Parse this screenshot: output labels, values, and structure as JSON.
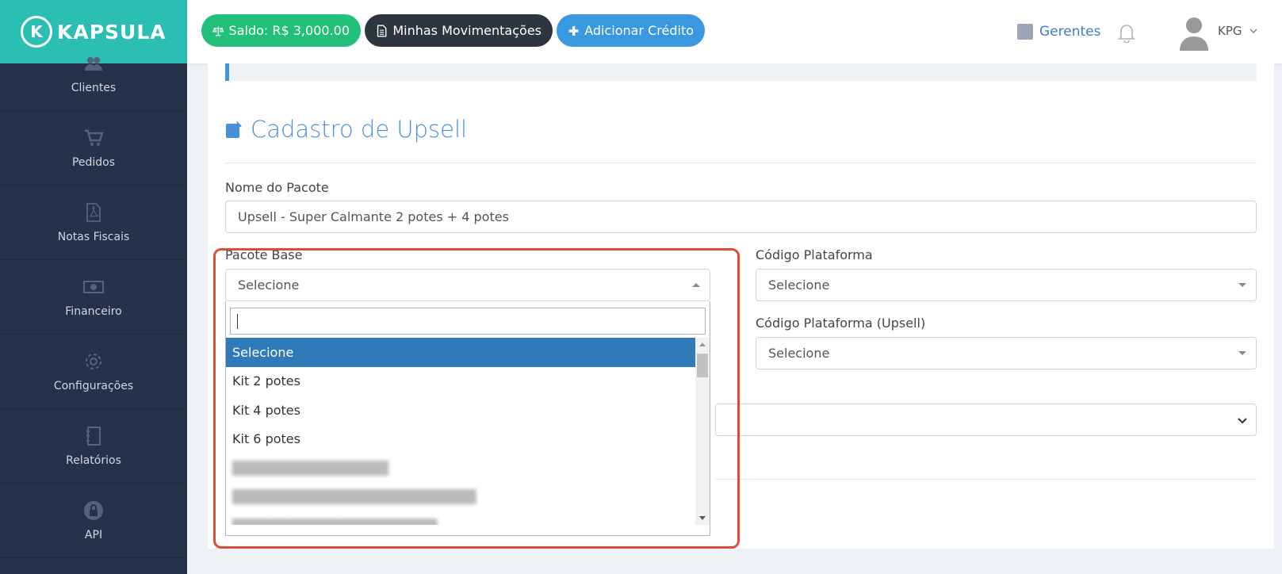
{
  "brand": {
    "mark": "K",
    "name": "KAPSULA"
  },
  "sidebar": {
    "items": [
      {
        "label": "Clientes",
        "icon": "users-icon"
      },
      {
        "label": "Pedidos",
        "icon": "cart-icon"
      },
      {
        "label": "Notas Fiscais",
        "icon": "pdf-file-icon"
      },
      {
        "label": "Financeiro",
        "icon": "money-icon"
      },
      {
        "label": "Configurações",
        "icon": "gear-icon"
      },
      {
        "label": "Relatórios",
        "icon": "notebook-icon"
      },
      {
        "label": "API",
        "icon": "lock-icon"
      }
    ]
  },
  "topbar": {
    "saldo": "Saldo: R$ 3,000.00",
    "movimentacoes": "Minhas Movimentações",
    "adicionar": "Adicionar Crédito",
    "gerentes": "Gerentes",
    "user": "KPG"
  },
  "form": {
    "title": "Cadastro de Upsell",
    "nome_label": "Nome do Pacote",
    "nome_value": "Upsell - Super Calmante 2 potes + 4 potes",
    "pacote_base_label": "Pacote Base",
    "pacote_base_value": "Selecione",
    "codigo_label": "Código Plataforma",
    "codigo_value": "Selecione",
    "codigo_upsell_label": "Código Plataforma (Upsell)",
    "codigo_upsell_value": "Selecione"
  },
  "dropdown": {
    "search_value": "",
    "options": [
      "Selecione",
      "Kit 2 potes",
      "Kit 4 potes",
      "Kit 6 potes"
    ]
  },
  "colors": {
    "brand": "#2bbfb3",
    "sidebar": "#263249",
    "saldo": "#23c07a",
    "movimentacoes": "#2d3540",
    "adicionar": "#3a98e0",
    "selected_option": "#2f7ab9",
    "highlight": "#e04b3a"
  }
}
